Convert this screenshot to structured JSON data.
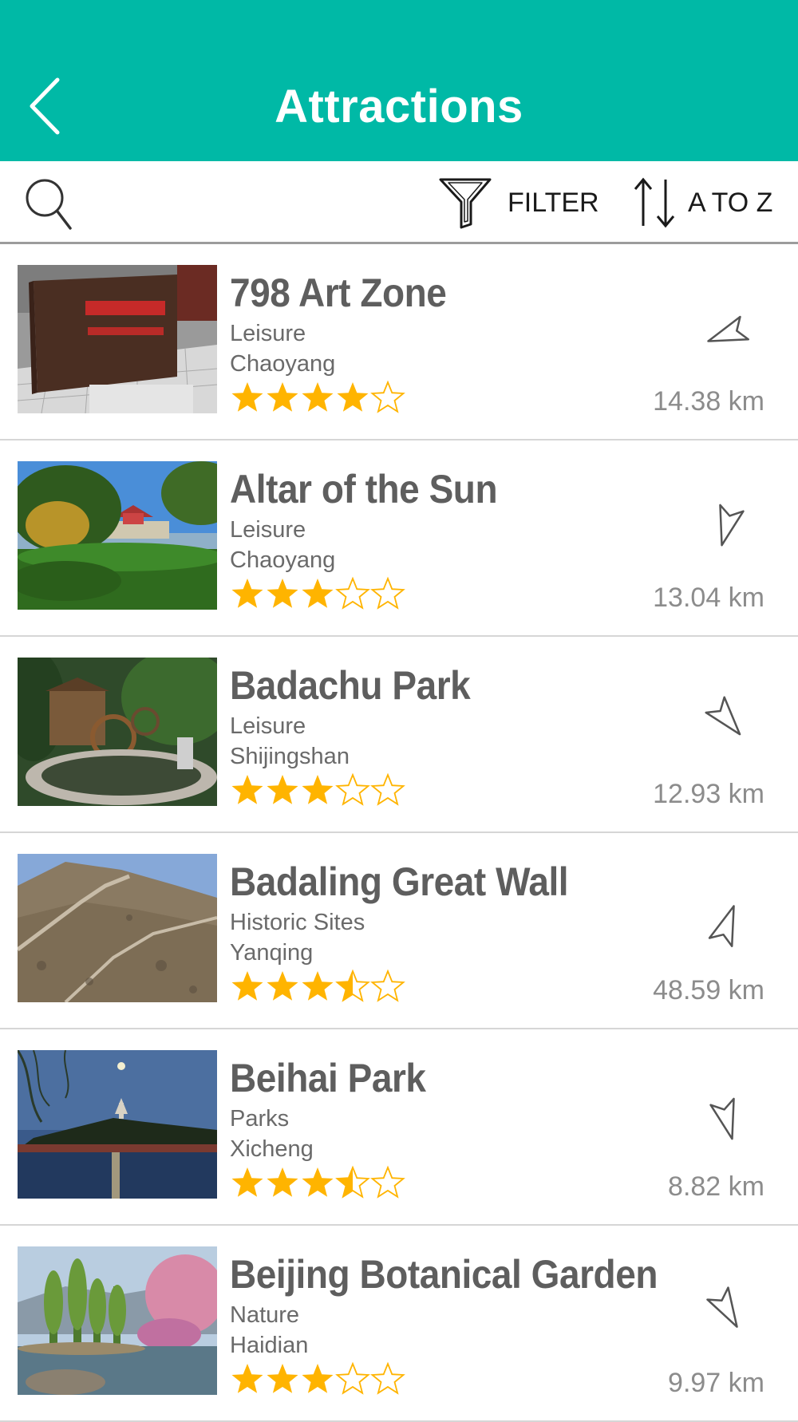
{
  "header": {
    "title": "Attractions",
    "back_icon": "chevron-left-icon"
  },
  "toolbar": {
    "search_icon": "search-icon",
    "filter_label": "FILTER",
    "sort_label": "A TO Z"
  },
  "colors": {
    "header_bg": "#00b9a6",
    "star": "#ffb400",
    "text": "#5a5a5a"
  },
  "attractions": [
    {
      "name": "798 Art Zone",
      "category": "Leisure",
      "district": "Chaoyang",
      "rating": 4,
      "distance": "14.38 km",
      "bearing": 250
    },
    {
      "name": "Altar of the Sun",
      "category": "Leisure",
      "district": "Chaoyang",
      "rating": 3,
      "distance": "13.04 km",
      "bearing": 195
    },
    {
      "name": "Badachu Park",
      "category": "Leisure",
      "district": "Shijingshan",
      "rating": 3,
      "distance": "12.93 km",
      "bearing": 140
    },
    {
      "name": "Badaling Great Wall",
      "category": "Historic Sites",
      "district": "Yanqing",
      "rating": 3.5,
      "distance": "48.59 km",
      "bearing": 20
    },
    {
      "name": "Beihai Park",
      "category": "Parks",
      "district": "Xicheng",
      "rating": 3.5,
      "distance": "8.82 km",
      "bearing": 165
    },
    {
      "name": "Beijing Botanical Garden",
      "category": "Nature",
      "district": "Haidian",
      "rating": 3,
      "distance": "9.97 km",
      "bearing": 150
    }
  ]
}
